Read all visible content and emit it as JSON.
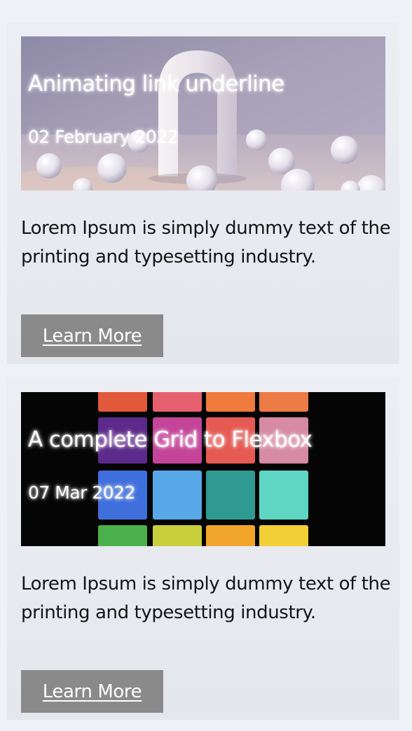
{
  "cards": [
    {
      "title": "Animating link underline",
      "date": "02 February 2022",
      "description": "Lorem Ipsum is simply dummy text of the printing and typesetting industry.",
      "button_label": "Learn More",
      "image": "arch-and-spheres-photo"
    },
    {
      "title": "A complete Grid to Flexbox",
      "date": "07 Mar 2022",
      "description": "Lorem Ipsum is simply dummy text of the printing and typesetting industry.",
      "button_label": "Learn More",
      "image": "eyeshadow-palette-photo"
    }
  ],
  "colors": {
    "page_background": "#eef1f6",
    "card_background": "#e8ebf0",
    "button_background": "#8a8a8a",
    "text": "#141414"
  }
}
